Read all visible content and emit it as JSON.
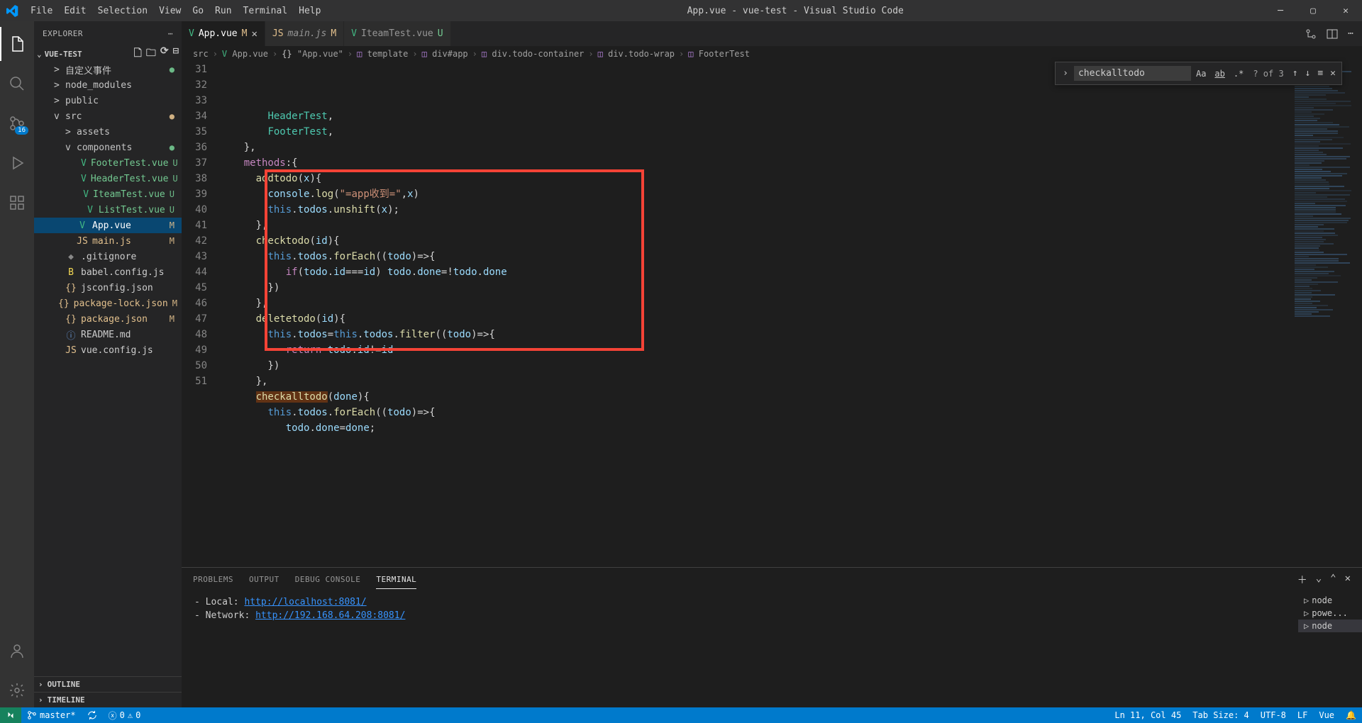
{
  "titlebar": {
    "title": "App.vue - vue-test - Visual Studio Code",
    "menu": [
      "File",
      "Edit",
      "Selection",
      "View",
      "Go",
      "Run",
      "Terminal",
      "Help"
    ]
  },
  "activitybar": {
    "badge": "16"
  },
  "sidebar": {
    "header": "EXPLORER",
    "section": "VUE-TEST",
    "items": [
      {
        "indent": "d1",
        "chev": ">",
        "icon": "folder",
        "label": "自定义事件",
        "status": "●",
        "statusCol": "col-mod-u"
      },
      {
        "indent": "d1",
        "chev": ">",
        "icon": "folder",
        "label": "node_modules",
        "status": "",
        "statusCol": ""
      },
      {
        "indent": "d1",
        "chev": ">",
        "icon": "folder",
        "label": "public",
        "status": "",
        "statusCol": ""
      },
      {
        "indent": "d1",
        "chev": "v",
        "icon": "folder",
        "label": "src",
        "status": "●",
        "statusCol": "col-mod-m"
      },
      {
        "indent": "d2",
        "chev": ">",
        "icon": "folder",
        "label": "assets",
        "status": "",
        "statusCol": ""
      },
      {
        "indent": "d2",
        "chev": "v",
        "icon": "folder",
        "label": "components",
        "status": "●",
        "statusCol": "col-mod-u"
      },
      {
        "indent": "d3",
        "chev": "",
        "icon": "vue",
        "label": "FooterTest.vue",
        "status": "U",
        "statusCol": "col-mod-u"
      },
      {
        "indent": "d3",
        "chev": "",
        "icon": "vue",
        "label": "HeaderTest.vue",
        "status": "U",
        "statusCol": "col-mod-u"
      },
      {
        "indent": "d3",
        "chev": "",
        "icon": "vue",
        "label": "IteamTest.vue",
        "status": "U",
        "statusCol": "col-mod-u"
      },
      {
        "indent": "d3",
        "chev": "",
        "icon": "vue",
        "label": "ListTest.vue",
        "status": "U",
        "statusCol": "col-mod-u"
      },
      {
        "indent": "d2",
        "chev": "",
        "icon": "vue",
        "label": "App.vue",
        "status": "M",
        "statusCol": "col-mod-m",
        "selected": true
      },
      {
        "indent": "d2",
        "chev": "",
        "icon": "js",
        "label": "main.js",
        "status": "M",
        "statusCol": "col-mod-m"
      },
      {
        "indent": "d1",
        "chev": "",
        "icon": "git",
        "label": ".gitignore",
        "status": "",
        "statusCol": ""
      },
      {
        "indent": "d1",
        "chev": "",
        "icon": "babel",
        "label": "babel.config.js",
        "status": "",
        "statusCol": ""
      },
      {
        "indent": "d1",
        "chev": "",
        "icon": "json",
        "label": "jsconfig.json",
        "status": "",
        "statusCol": ""
      },
      {
        "indent": "d1",
        "chev": "",
        "icon": "json",
        "label": "package-lock.json",
        "status": "M",
        "statusCol": "col-mod-m"
      },
      {
        "indent": "d1",
        "chev": "",
        "icon": "json",
        "label": "package.json",
        "status": "M",
        "statusCol": "col-mod-m"
      },
      {
        "indent": "d1",
        "chev": "",
        "icon": "md",
        "label": "README.md",
        "status": "",
        "statusCol": ""
      },
      {
        "indent": "d1",
        "chev": "",
        "icon": "js",
        "label": "vue.config.js",
        "status": "",
        "statusCol": ""
      }
    ],
    "outline": "OUTLINE",
    "timeline": "TIMELINE"
  },
  "tabs": [
    {
      "icon": "vue",
      "label": "App.vue",
      "status": "M",
      "active": true,
      "close": true
    },
    {
      "icon": "js",
      "label": "main.js",
      "status": "M",
      "active": false,
      "close": false,
      "italic": true
    },
    {
      "icon": "vue",
      "label": "IteamTest.vue",
      "status": "U",
      "active": false,
      "close": false
    }
  ],
  "breadcrumb": [
    {
      "icon": "",
      "label": "src"
    },
    {
      "icon": "vue",
      "label": "App.vue"
    },
    {
      "icon": "brkt",
      "label": "\"App.vue\""
    },
    {
      "icon": "cube",
      "label": "template"
    },
    {
      "icon": "cube",
      "label": "div#app"
    },
    {
      "icon": "cube",
      "label": "div.todo-container"
    },
    {
      "icon": "cube",
      "label": "div.todo-wrap"
    },
    {
      "icon": "cube",
      "label": "FooterTest"
    }
  ],
  "find": {
    "value": "checkalltodo",
    "aa": "Aa",
    "ab": "ab",
    "re": ".*",
    "count": "? of 3"
  },
  "code": {
    "startLine": 31,
    "lines": [
      "        HeaderTest,",
      "        FooterTest,",
      "    },",
      "    methods:{",
      "      addtodo(x){",
      "        console.log(\"=app收到=\",x)",
      "        this.todos.unshift(x);",
      "      },",
      "      checktodo(id){",
      "        this.todos.forEach((todo)=>{",
      "           if(todo.id===id) todo.done=!todo.done",
      "        })",
      "      },",
      "      deletetodo(id){",
      "        this.todos=this.todos.filter((todo)=>{",
      "           return todo.id!=id",
      "        })",
      "      },",
      "      checkalltodo(done){",
      "        this.todos.forEach((todo)=>{",
      "           todo.done=done;"
    ]
  },
  "panel": {
    "tabs": [
      "PROBLEMS",
      "OUTPUT",
      "DEBUG CONSOLE",
      "TERMINAL"
    ],
    "terminal": {
      "l1_label": "  - Local:   ",
      "l1_url": "http://localhost:8081/",
      "l2_label": "  - Network: ",
      "l2_url": "http://192.168.64.208:8081/"
    },
    "termItems": [
      "node",
      "powe...",
      "node"
    ]
  },
  "statusbar": {
    "branch": "master*",
    "errors": "0",
    "warnings": "0",
    "pos": "Ln 11, Col 45",
    "tabsize": "Tab Size: 4",
    "encoding": "UTF-8",
    "eol": "LF",
    "lang": "Vue"
  }
}
